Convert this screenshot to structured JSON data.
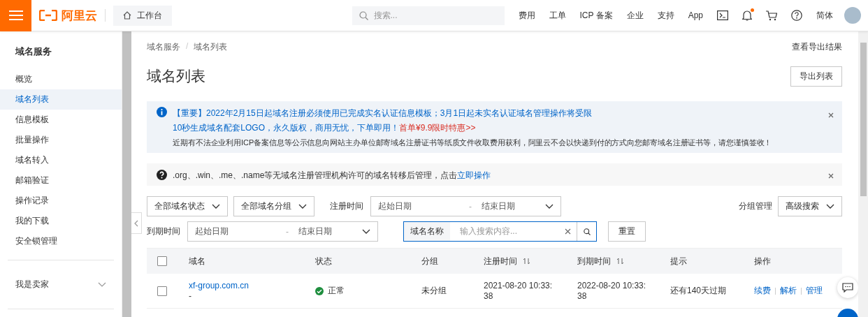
{
  "header": {
    "brand": "阿里云",
    "workbench": "工作台",
    "search": {
      "placeholder": "搜索..."
    },
    "nav_links": [
      "费用",
      "工单",
      "ICP 备案",
      "企业",
      "支持",
      "App"
    ],
    "notification_dot": true,
    "language": "简体"
  },
  "sidebar": {
    "title": "域名服务",
    "items": [
      {
        "label": "概览",
        "selected": false
      },
      {
        "label": "域名列表",
        "selected": true
      },
      {
        "label": "信息模板",
        "selected": false
      },
      {
        "label": "批量操作",
        "selected": false
      },
      {
        "label": "域名转入",
        "selected": false
      },
      {
        "label": "邮箱验证",
        "selected": false
      },
      {
        "label": "操作记录",
        "selected": false
      },
      {
        "label": "我的下载",
        "selected": false
      },
      {
        "label": "安全锁管理",
        "selected": false
      }
    ],
    "groups": [
      {
        "label": "我是卖家",
        "expanded": false
      }
    ]
  },
  "breadcrumb": [
    "域名服务",
    "域名列表"
  ],
  "breadcrumb_separator": "/",
  "export_results_link": "查看导出结果",
  "page_title": "域名列表",
  "export_button": "导出列表",
  "notices": [
    {
      "kind": "info",
      "lines": [
        {
          "kind": "link",
          "text": "【重要】2022年2月15日起域名注册必须使用已完成实名认证信息模板；3月1日起未实名认证域名管理操作将受限"
        },
        {
          "kind": "promo",
          "text": "10秒生成域名配套LOGO，永久版权，商用无忧，下单即用！",
          "highlight": "首单¥9.9限时特惠>>"
        },
        {
          "kind": "plain",
          "text": "近期有不法企业利用ICP备案信息等公示信息向网站主办单位邮寄域名注册证书等纸质文件收取费用获利，阿里云不会以快递到付的方式向您邮寄域名注册证书等，请您谨慎签收！"
        }
      ]
    },
    {
      "kind": "help",
      "lines": [
        {
          "kind": "action",
          "text": ".org、.win、.me、.name等无域名注册管理机构许可的域名转移后管理，点击",
          "link": "立即操作"
        }
      ]
    }
  ],
  "filters": {
    "status_select": "全部域名状态",
    "group_select": "全部域名分组",
    "registration": {
      "label": "注册时间",
      "start": "起始日期",
      "separator": "-",
      "end": "结束日期"
    },
    "group_manage": "分组管理",
    "advanced_search": "高级搜索",
    "expiry": {
      "label": "到期时间",
      "start": "起始日期",
      "separator": "-",
      "end": "结束日期"
    },
    "search": {
      "field_type": "域名名称",
      "placeholder": "输入搜索内容..."
    },
    "reset_button": "重置"
  },
  "table": {
    "columns": [
      {
        "label": "域名",
        "sortable": false
      },
      {
        "label": "状态",
        "sortable": false
      },
      {
        "label": "分组",
        "sortable": false
      },
      {
        "label": "注册时间",
        "sortable": true
      },
      {
        "label": "到期时间",
        "sortable": true
      },
      {
        "label": "提示",
        "sortable": false
      },
      {
        "label": "操作",
        "sortable": false
      }
    ],
    "all_checked": false,
    "rows": [
      {
        "checked": false,
        "domain": "xf-group.com.cn",
        "domain_note": "-",
        "status": "正常",
        "group": "未分组",
        "registered": "2021-08-20 10:33:38",
        "expires": "2022-08-20 10:33:38",
        "hint": "还有140天过期",
        "actions": [
          "续费",
          "解析",
          "管理"
        ]
      }
    ]
  }
}
